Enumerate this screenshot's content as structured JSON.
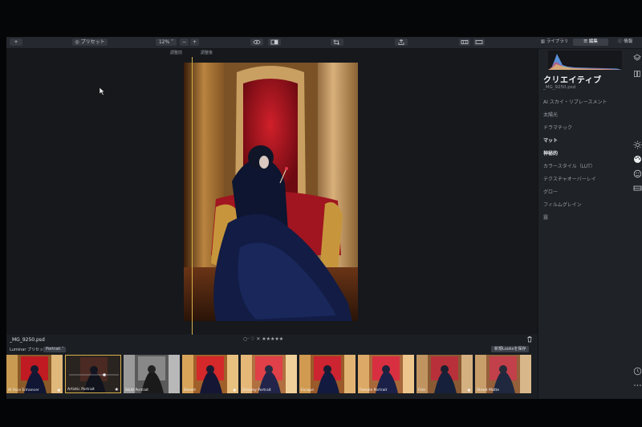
{
  "toolbar": {
    "add_label": "+",
    "presets_label": "プリセット",
    "zoom_value": "12%",
    "zoom_out": "−",
    "zoom_in": "+"
  },
  "tabs": {
    "library": "ライブラリ",
    "edit": "編集",
    "info": "情報"
  },
  "compare": {
    "before": "調整前",
    "after": "調整後"
  },
  "panel": {
    "title": "クリエイティブ",
    "filename": "_MG_9250.psd",
    "tools": [
      "AI スカイ・リプレースメント",
      "太陽光",
      "ドラマチック",
      "マット",
      "神秘的",
      "カラースタイル（LUT）",
      "テクスチャオーバーレイ",
      "グロー",
      "フィルムグレイン",
      "霧"
    ]
  },
  "footer": {
    "filename": "_MG_9250.psd",
    "rating": "○·  ♡   ✕ ★★★★★",
    "preset_collection": "Luminar プリセット",
    "preset_category": "Portrait",
    "save_looks": "新規Looksを保存"
  },
  "presets": [
    {
      "name": "AI Face Enhancer",
      "style": "warm"
    },
    {
      "name": "Artistic Portrait",
      "style": "dark"
    },
    {
      "name": "B&W Portrait",
      "style": "bw"
    },
    {
      "name": "Desert",
      "style": "warm"
    },
    {
      "name": "Dreamy Portrait",
      "style": "warm"
    },
    {
      "name": "Escape",
      "style": "warm"
    },
    {
      "name": "Female Portrait",
      "style": "warm"
    },
    {
      "name": "Film",
      "style": "warm"
    },
    {
      "name": "Street Matte",
      "style": "warm"
    }
  ],
  "colors": {
    "accent": "#d7b24a",
    "panel_bg": "#1f2227",
    "canvas_bg": "#16181c"
  }
}
